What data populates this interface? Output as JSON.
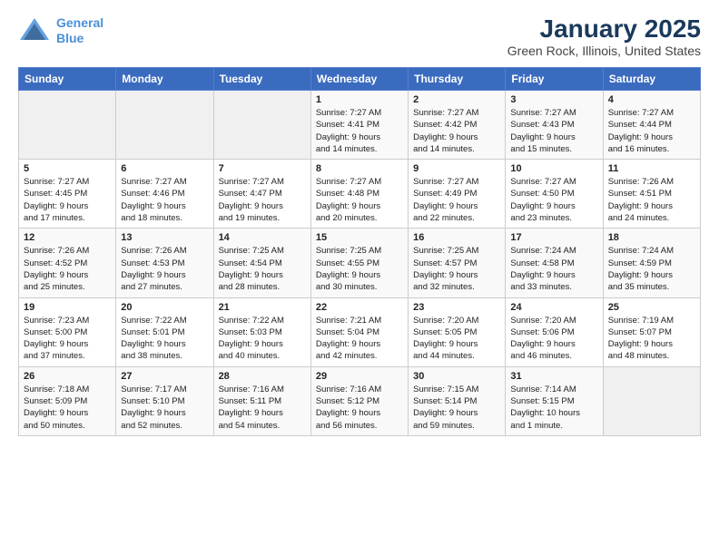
{
  "header": {
    "logo_line1": "General",
    "logo_line2": "Blue",
    "title": "January 2025",
    "subtitle": "Green Rock, Illinois, United States"
  },
  "weekdays": [
    "Sunday",
    "Monday",
    "Tuesday",
    "Wednesday",
    "Thursday",
    "Friday",
    "Saturday"
  ],
  "weeks": [
    [
      {
        "day": "",
        "info": ""
      },
      {
        "day": "",
        "info": ""
      },
      {
        "day": "",
        "info": ""
      },
      {
        "day": "1",
        "info": "Sunrise: 7:27 AM\nSunset: 4:41 PM\nDaylight: 9 hours\nand 14 minutes."
      },
      {
        "day": "2",
        "info": "Sunrise: 7:27 AM\nSunset: 4:42 PM\nDaylight: 9 hours\nand 14 minutes."
      },
      {
        "day": "3",
        "info": "Sunrise: 7:27 AM\nSunset: 4:43 PM\nDaylight: 9 hours\nand 15 minutes."
      },
      {
        "day": "4",
        "info": "Sunrise: 7:27 AM\nSunset: 4:44 PM\nDaylight: 9 hours\nand 16 minutes."
      }
    ],
    [
      {
        "day": "5",
        "info": "Sunrise: 7:27 AM\nSunset: 4:45 PM\nDaylight: 9 hours\nand 17 minutes."
      },
      {
        "day": "6",
        "info": "Sunrise: 7:27 AM\nSunset: 4:46 PM\nDaylight: 9 hours\nand 18 minutes."
      },
      {
        "day": "7",
        "info": "Sunrise: 7:27 AM\nSunset: 4:47 PM\nDaylight: 9 hours\nand 19 minutes."
      },
      {
        "day": "8",
        "info": "Sunrise: 7:27 AM\nSunset: 4:48 PM\nDaylight: 9 hours\nand 20 minutes."
      },
      {
        "day": "9",
        "info": "Sunrise: 7:27 AM\nSunset: 4:49 PM\nDaylight: 9 hours\nand 22 minutes."
      },
      {
        "day": "10",
        "info": "Sunrise: 7:27 AM\nSunset: 4:50 PM\nDaylight: 9 hours\nand 23 minutes."
      },
      {
        "day": "11",
        "info": "Sunrise: 7:26 AM\nSunset: 4:51 PM\nDaylight: 9 hours\nand 24 minutes."
      }
    ],
    [
      {
        "day": "12",
        "info": "Sunrise: 7:26 AM\nSunset: 4:52 PM\nDaylight: 9 hours\nand 25 minutes."
      },
      {
        "day": "13",
        "info": "Sunrise: 7:26 AM\nSunset: 4:53 PM\nDaylight: 9 hours\nand 27 minutes."
      },
      {
        "day": "14",
        "info": "Sunrise: 7:25 AM\nSunset: 4:54 PM\nDaylight: 9 hours\nand 28 minutes."
      },
      {
        "day": "15",
        "info": "Sunrise: 7:25 AM\nSunset: 4:55 PM\nDaylight: 9 hours\nand 30 minutes."
      },
      {
        "day": "16",
        "info": "Sunrise: 7:25 AM\nSunset: 4:57 PM\nDaylight: 9 hours\nand 32 minutes."
      },
      {
        "day": "17",
        "info": "Sunrise: 7:24 AM\nSunset: 4:58 PM\nDaylight: 9 hours\nand 33 minutes."
      },
      {
        "day": "18",
        "info": "Sunrise: 7:24 AM\nSunset: 4:59 PM\nDaylight: 9 hours\nand 35 minutes."
      }
    ],
    [
      {
        "day": "19",
        "info": "Sunrise: 7:23 AM\nSunset: 5:00 PM\nDaylight: 9 hours\nand 37 minutes."
      },
      {
        "day": "20",
        "info": "Sunrise: 7:22 AM\nSunset: 5:01 PM\nDaylight: 9 hours\nand 38 minutes."
      },
      {
        "day": "21",
        "info": "Sunrise: 7:22 AM\nSunset: 5:03 PM\nDaylight: 9 hours\nand 40 minutes."
      },
      {
        "day": "22",
        "info": "Sunrise: 7:21 AM\nSunset: 5:04 PM\nDaylight: 9 hours\nand 42 minutes."
      },
      {
        "day": "23",
        "info": "Sunrise: 7:20 AM\nSunset: 5:05 PM\nDaylight: 9 hours\nand 44 minutes."
      },
      {
        "day": "24",
        "info": "Sunrise: 7:20 AM\nSunset: 5:06 PM\nDaylight: 9 hours\nand 46 minutes."
      },
      {
        "day": "25",
        "info": "Sunrise: 7:19 AM\nSunset: 5:07 PM\nDaylight: 9 hours\nand 48 minutes."
      }
    ],
    [
      {
        "day": "26",
        "info": "Sunrise: 7:18 AM\nSunset: 5:09 PM\nDaylight: 9 hours\nand 50 minutes."
      },
      {
        "day": "27",
        "info": "Sunrise: 7:17 AM\nSunset: 5:10 PM\nDaylight: 9 hours\nand 52 minutes."
      },
      {
        "day": "28",
        "info": "Sunrise: 7:16 AM\nSunset: 5:11 PM\nDaylight: 9 hours\nand 54 minutes."
      },
      {
        "day": "29",
        "info": "Sunrise: 7:16 AM\nSunset: 5:12 PM\nDaylight: 9 hours\nand 56 minutes."
      },
      {
        "day": "30",
        "info": "Sunrise: 7:15 AM\nSunset: 5:14 PM\nDaylight: 9 hours\nand 59 minutes."
      },
      {
        "day": "31",
        "info": "Sunrise: 7:14 AM\nSunset: 5:15 PM\nDaylight: 10 hours\nand 1 minute."
      },
      {
        "day": "",
        "info": ""
      }
    ]
  ]
}
